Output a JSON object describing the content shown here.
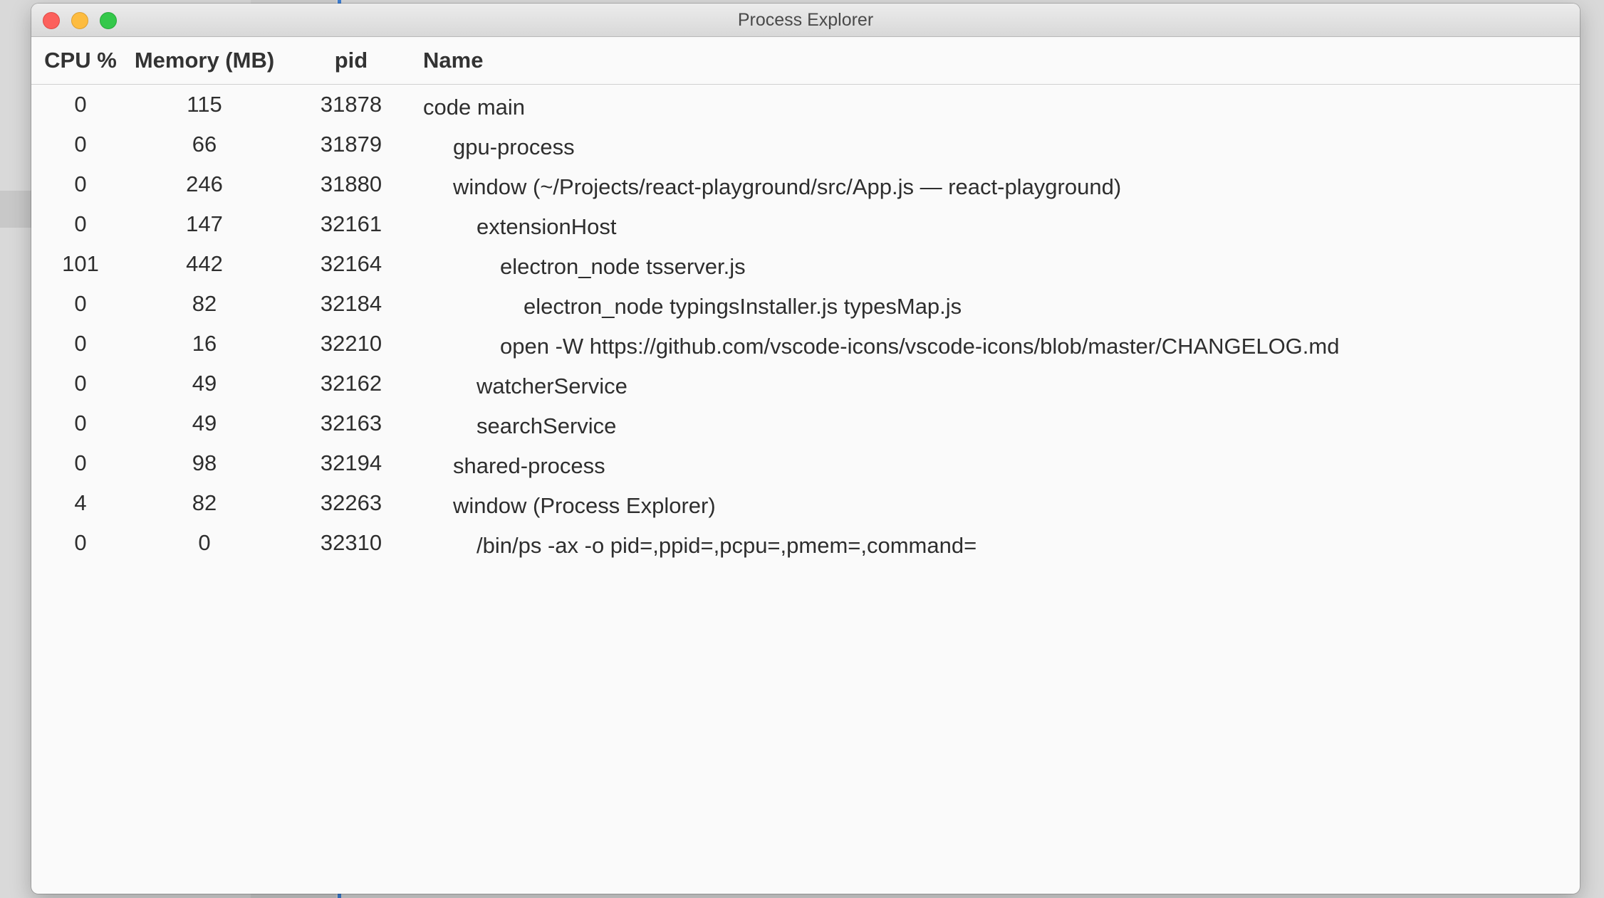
{
  "window": {
    "title": "Process Explorer"
  },
  "columns": {
    "cpu": "CPU %",
    "memory": "Memory (MB)",
    "pid": "pid",
    "name": "Name"
  },
  "processes": [
    {
      "cpu": "0",
      "memory": "115",
      "pid": "31878",
      "name": "code main",
      "depth": 0
    },
    {
      "cpu": "0",
      "memory": "66",
      "pid": "31879",
      "name": "gpu-process",
      "depth": 1
    },
    {
      "cpu": "0",
      "memory": "246",
      "pid": "31880",
      "name": "window (~/Projects/react-playground/src/App.js — react-playground)",
      "depth": 1
    },
    {
      "cpu": "0",
      "memory": "147",
      "pid": "32161",
      "name": "extensionHost",
      "depth": 2
    },
    {
      "cpu": "101",
      "memory": "442",
      "pid": "32164",
      "name": "electron_node tsserver.js",
      "depth": 3
    },
    {
      "cpu": "0",
      "memory": "82",
      "pid": "32184",
      "name": "electron_node typingsInstaller.js typesMap.js",
      "depth": 4
    },
    {
      "cpu": "0",
      "memory": "16",
      "pid": "32210",
      "name": "open -W https://github.com/vscode-icons/vscode-icons/blob/master/CHANGELOG.md",
      "depth": 3
    },
    {
      "cpu": "0",
      "memory": "49",
      "pid": "32162",
      "name": "watcherService",
      "depth": 2
    },
    {
      "cpu": "0",
      "memory": "49",
      "pid": "32163",
      "name": "searchService",
      "depth": 2
    },
    {
      "cpu": "0",
      "memory": "98",
      "pid": "32194",
      "name": "shared-process",
      "depth": 1
    },
    {
      "cpu": "4",
      "memory": "82",
      "pid": "32263",
      "name": "window (Process Explorer)",
      "depth": 1
    },
    {
      "cpu": "0",
      "memory": "0",
      "pid": "32310",
      "name": "/bin/ps -ax -o pid=,ppid=,pcpu=,pmem=,command=",
      "depth": 2
    }
  ]
}
